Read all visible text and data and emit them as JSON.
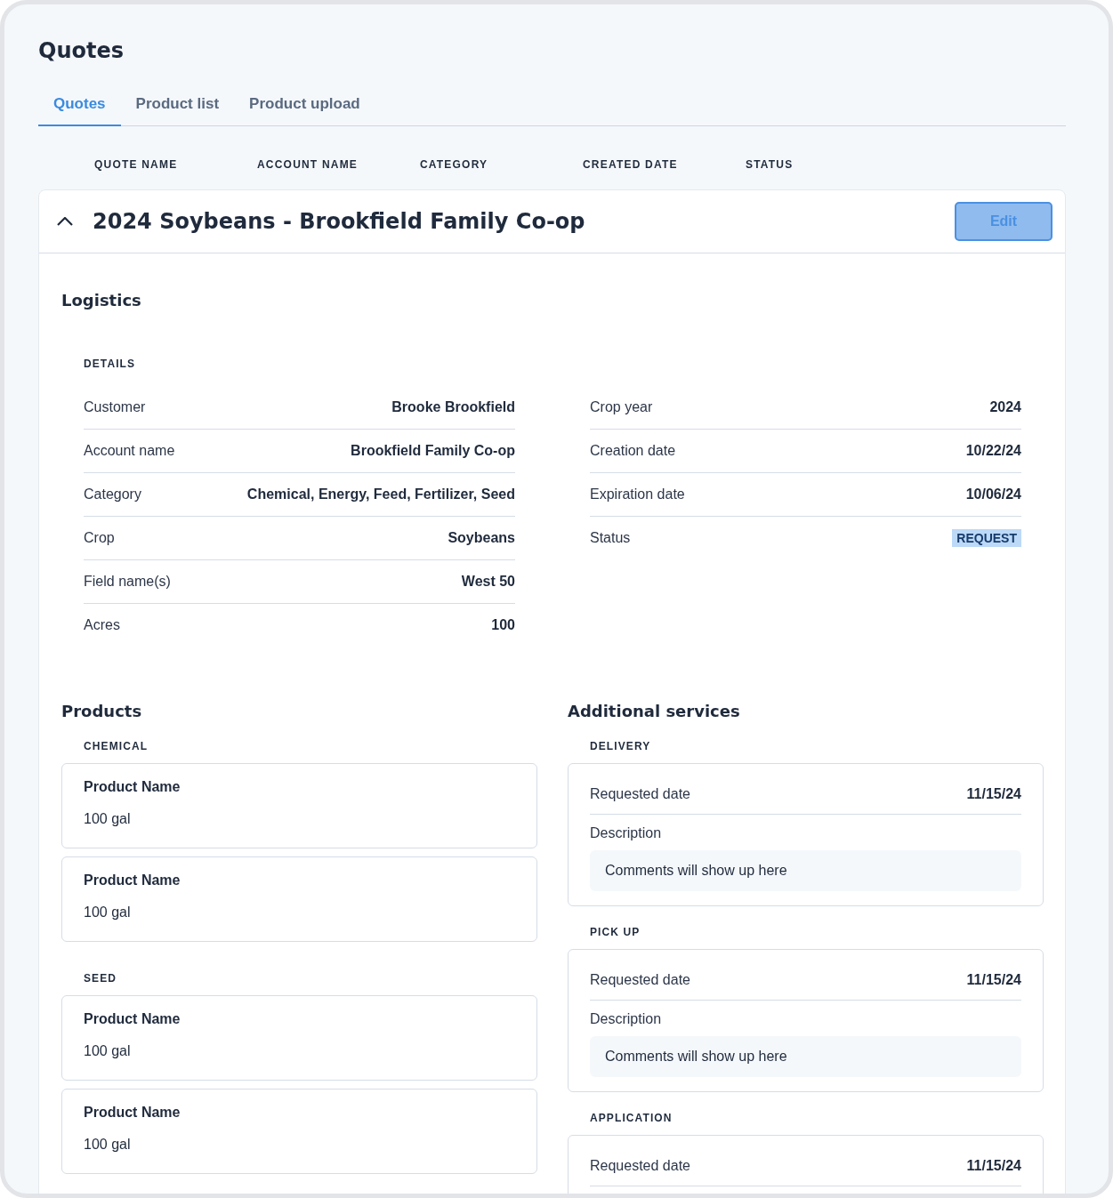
{
  "title": "Quotes",
  "tabs": [
    {
      "label": "Quotes",
      "selected": true
    },
    {
      "label": "Product list",
      "selected": false
    },
    {
      "label": "Product upload",
      "selected": false
    }
  ],
  "columns": [
    "QUOTE NAME",
    "ACCOUNT NAME",
    "CATEGORY",
    "CREATED DATE",
    "STATUS"
  ],
  "quote": {
    "title": "2024 Soybeans - Brookfield Family Co-op",
    "expanded": true,
    "edit_button": "Edit",
    "logistics": {
      "heading": "Logistics",
      "details_heading": "DETAILS",
      "left_rows": [
        {
          "label": "Customer",
          "value": "Brooke Brookfield",
          "kind": "text"
        },
        {
          "label": "Account name",
          "value": "Brookfield Family Co-op",
          "kind": "text"
        },
        {
          "label": "Category",
          "value": "Chemical, Energy, Feed, Fertilizer, Seed",
          "kind": "text"
        },
        {
          "label": "Crop",
          "value": "Soybeans",
          "kind": "text"
        },
        {
          "label": "Field name(s)",
          "value": "West 50",
          "kind": "text"
        },
        {
          "label": "Acres",
          "value": "100",
          "kind": "text"
        }
      ],
      "right_rows": [
        {
          "label": "Crop year",
          "value": "2024",
          "kind": "text"
        },
        {
          "label": "Creation date",
          "value": "10/22/24",
          "kind": "text"
        },
        {
          "label": "Expiration date",
          "value": "10/06/24",
          "kind": "text"
        },
        {
          "label": "Status",
          "value": "REQUEST",
          "kind": "badge"
        }
      ]
    },
    "products": {
      "heading": "Products",
      "groups": [
        {
          "name": "CHEMICAL",
          "items": [
            {
              "name": "Product Name",
              "amount": "100 gal"
            },
            {
              "name": "Product Name",
              "amount": "100 gal"
            }
          ]
        },
        {
          "name": "SEED",
          "items": [
            {
              "name": "Product Name",
              "amount": "100 gal"
            },
            {
              "name": "Product Name",
              "amount": "100 gal"
            }
          ]
        }
      ]
    },
    "services": {
      "heading": "Additional services",
      "groups": [
        {
          "name": "DELIVERY",
          "date_label": "Requested date",
          "date": "11/15/24",
          "description_label": "Description",
          "comment": "Comments will show up here"
        },
        {
          "name": "PICK UP",
          "date_label": "Requested date",
          "date": "11/15/24",
          "description_label": "Description",
          "comment": "Comments will show up here"
        },
        {
          "name": "APPLICATION",
          "date_label": "Requested date",
          "date": "11/15/24"
        }
      ]
    }
  }
}
